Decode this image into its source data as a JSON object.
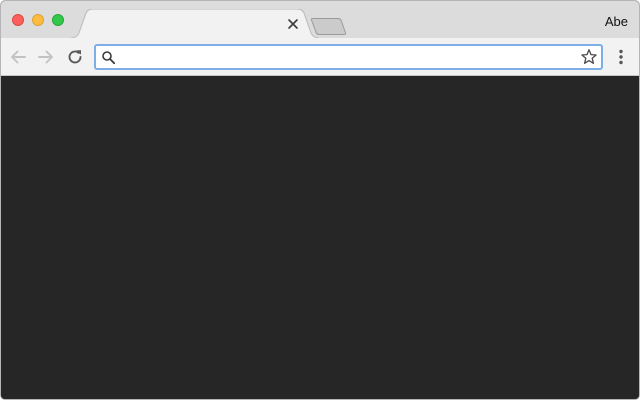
{
  "window": {
    "traffic_lights": {
      "close_color": "#fc605c",
      "minimize_color": "#fdbc40",
      "zoom_color": "#34c84a"
    },
    "active_tab": {
      "title": "",
      "close_icon": "close-x-icon"
    },
    "new_tab_icon": "new-tab-icon",
    "profile_name": "Abe"
  },
  "toolbar": {
    "back_icon": "arrow-left-icon",
    "forward_icon": "arrow-right-icon",
    "reload_icon": "reload-icon",
    "menu_icon": "kebab-menu-icon",
    "omnibox": {
      "value": "",
      "placeholder": "",
      "search_icon": "search-icon",
      "bookmark_icon": "star-outline-icon",
      "focus_color": "#7eaee6"
    }
  },
  "content": {
    "background_color": "#262626"
  }
}
